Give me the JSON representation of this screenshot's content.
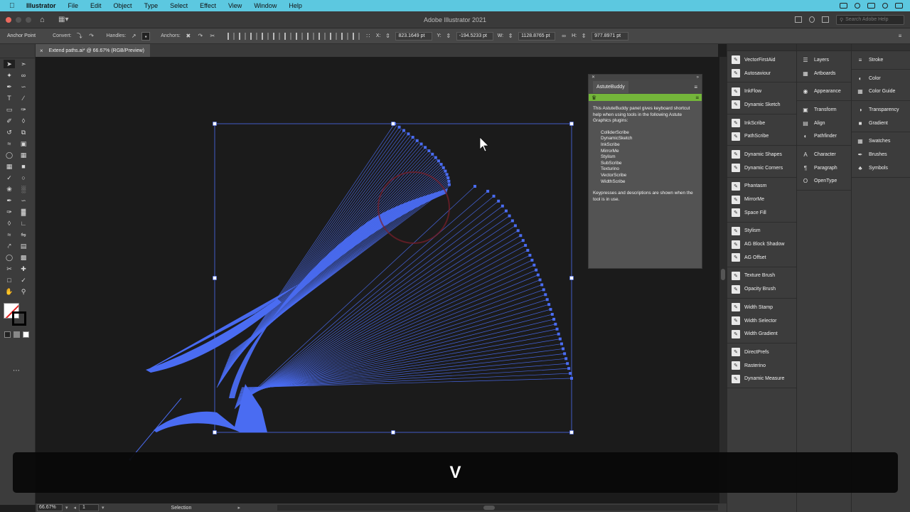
{
  "menubar": {
    "apple_icon": "apple-icon",
    "items": [
      "Illustrator",
      "File",
      "Edit",
      "Object",
      "Type",
      "Select",
      "Effect",
      "View",
      "Window",
      "Help"
    ]
  },
  "titlebar": {
    "title": "Adobe Illustrator 2021",
    "search_placeholder": "Search Adobe Help"
  },
  "controlbar": {
    "tool_label": "Anchor Point",
    "convert_label": "Convert:",
    "handles_label": "Handles:",
    "anchors_label": "Anchors:",
    "x_label": "X:",
    "x_value": "823.1649 pt",
    "y_label": "Y:",
    "y_value": "-194.5233 pt",
    "w_label": "W:",
    "w_value": "1128.8765 pt",
    "h_label": "H:",
    "h_value": "977.8971 pt"
  },
  "document_tab": {
    "label": "Extend paths.ai* @ 66.67% (RGB/Preview)",
    "close": "×"
  },
  "statusbar": {
    "zoom": "66.67%",
    "page": "1",
    "current_tool": "Selection"
  },
  "astute_panel": {
    "tab": "AstuteBuddy",
    "intro": "This AstuteBuddy panel gives keyboard shortcut help when using tools in the following Astute Graphics plugins:",
    "plugins": [
      "ColliderScribe",
      "DynamicSketch",
      "InkScribe",
      "MirrorMe",
      "Stylism",
      "SubScribe",
      "Texturino",
      "VectorScribe",
      "WidthScribe"
    ],
    "footer": "Keypresses and descriptions are shown when the tool is in use."
  },
  "dock": {
    "col1": [
      [
        "VectorFirstAid",
        "Autosaviour"
      ],
      [
        "InkFlow",
        "Dynamic Sketch"
      ],
      [
        "InkScribe",
        "PathScribe"
      ],
      [
        "Dynamic Shapes",
        "Dynamic Corners"
      ],
      [
        "Phantasm",
        "MirrorMe",
        "Space Fill"
      ],
      [
        "Stylism",
        "AG Block Shadow",
        "AG Offset"
      ],
      [
        "Texture Brush",
        "Opacity Brush"
      ],
      [
        "Width Stamp",
        "Width Selector",
        "Width Gradient"
      ],
      [
        "DirectPrefs",
        "Rasterino",
        "Dynamic Measure"
      ]
    ],
    "col2": [
      [
        "Layers",
        "Artboards"
      ],
      [
        "Appearance"
      ],
      [
        "Transform",
        "Align",
        "Pathfinder"
      ],
      [
        "Character",
        "Paragraph",
        "OpenType"
      ]
    ],
    "col3": [
      [
        "Stroke"
      ],
      [
        "Color",
        "Color Guide"
      ],
      [
        "Transparency",
        "Gradient"
      ],
      [
        "Swatches",
        "Brushes",
        "Symbols"
      ]
    ]
  },
  "keystroke_overlay": "V",
  "colors": {
    "menubar": "#5cc8e0",
    "artwork": "#4a6cf2",
    "selection": "#4a6cf2",
    "plugin_green": "#74b63a"
  }
}
